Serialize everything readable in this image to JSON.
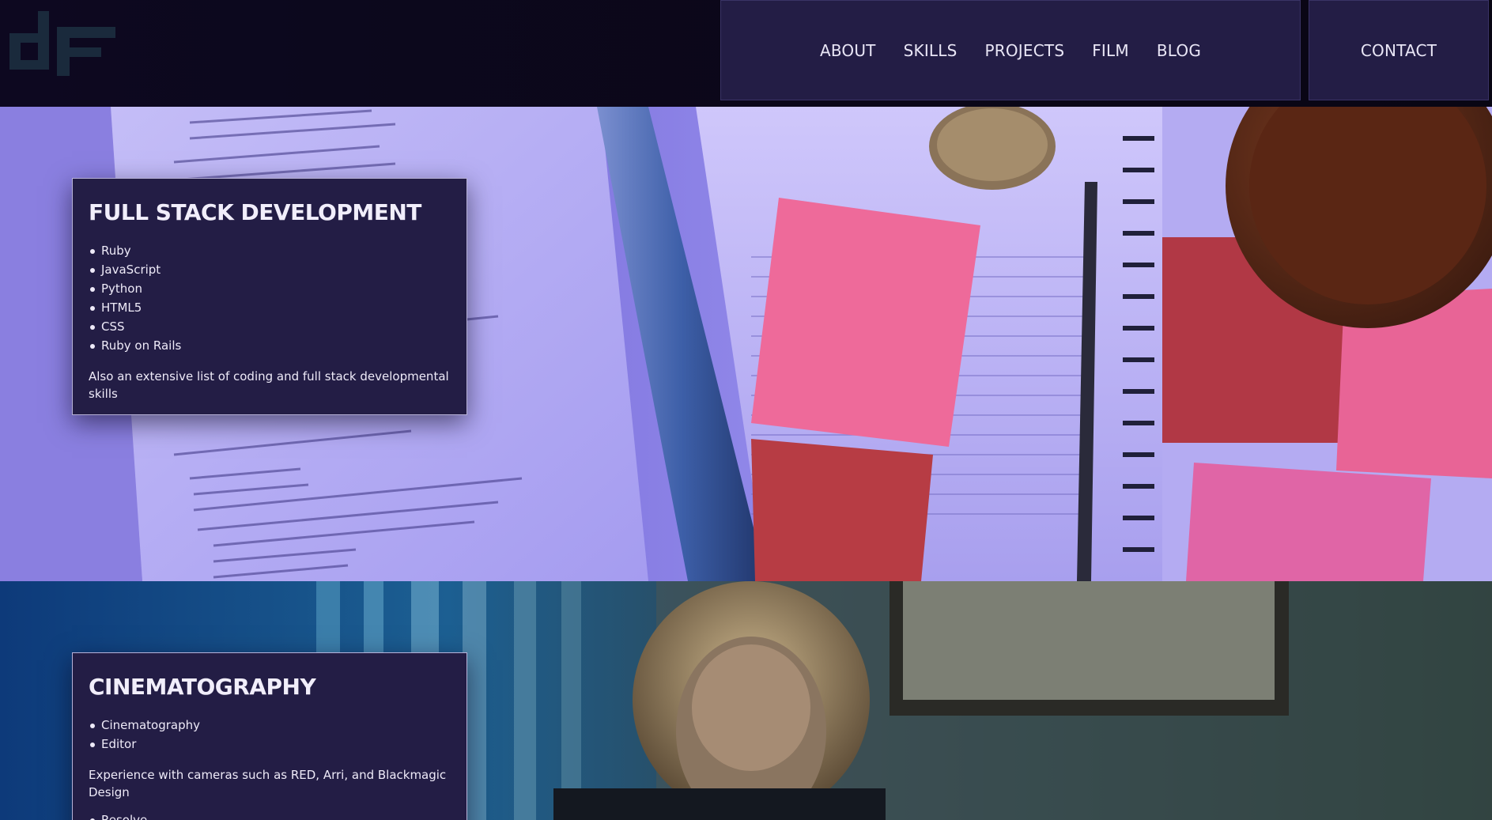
{
  "header": {
    "logo_text": "dF",
    "nav": {
      "about": "ABOUT",
      "skills": "SKILLS",
      "projects": "PROJECTS",
      "film": "FILM",
      "blog": "BLOG"
    },
    "contact": "CONTACT"
  },
  "sections": {
    "fullstack": {
      "title": "FULL STACK DEVELOPMENT",
      "skills": [
        "Ruby",
        "JavaScript",
        "Python",
        "HTML5",
        "CSS",
        "Ruby on Rails"
      ],
      "note": "Also an extensive list of coding and full stack developmental skills"
    },
    "cinema": {
      "title": "CINEMATOGRAPHY",
      "roles": [
        "Cinematography",
        "Editor"
      ],
      "note": "Experience with cameras such as RED, Arri, and Blackmagic Design",
      "tools": [
        "Resolve"
      ]
    }
  },
  "colors": {
    "nav_bg": "#231d45",
    "card_bg": "#231d45",
    "page_bg": "#0b0716"
  }
}
